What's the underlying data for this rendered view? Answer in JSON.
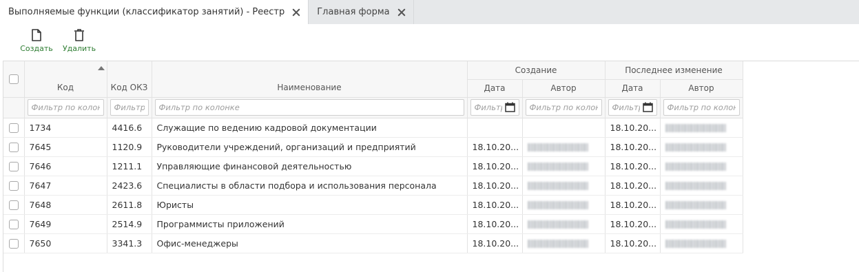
{
  "tabs": [
    {
      "label": "Выполняемые функции (классификатор занятий) - Реестр",
      "active": true
    },
    {
      "label": "Главная форма",
      "active": false
    }
  ],
  "toolbar": {
    "create_label": "Создать",
    "delete_label": "Удалить"
  },
  "grid": {
    "headers": {
      "code": "Код",
      "okz": "Код ОКЗ",
      "name": "Наименование",
      "creation": "Создание",
      "last_change": "Последнее изменение",
      "date": "Дата",
      "author": "Автор"
    },
    "filter_placeholder": "Фильтр по колонке",
    "rows": [
      {
        "code": "1734",
        "okz": "4416.6",
        "name": "Служащие по ведению кадровой документации",
        "created_date": "",
        "created_author": "",
        "changed_date": "18.10.20...",
        "changed_author": "(blurred)"
      },
      {
        "code": "7645",
        "okz": "1120.9",
        "name": "Руководители учреждений, организаций и предприятий",
        "created_date": "18.10.20...",
        "created_author": "(blurred)",
        "changed_date": "18.10.20...",
        "changed_author": "(blurred)"
      },
      {
        "code": "7646",
        "okz": "1211.1",
        "name": "Управляющие финансовой деятельностью",
        "created_date": "18.10.20...",
        "created_author": "(blurred)",
        "changed_date": "18.10.20...",
        "changed_author": "(blurred)"
      },
      {
        "code": "7647",
        "okz": "2423.6",
        "name": "Специалисты в области подбора и использования персонала",
        "created_date": "18.10.20...",
        "created_author": "(blurred)",
        "changed_date": "18.10.20...",
        "changed_author": "(blurred)"
      },
      {
        "code": "7648",
        "okz": "2611.8",
        "name": "Юристы",
        "created_date": "18.10.20...",
        "created_author": "(blurred)",
        "changed_date": "18.10.20...",
        "changed_author": "(blurred)"
      },
      {
        "code": "7649",
        "okz": "2514.9",
        "name": "Программисты приложений",
        "created_date": "18.10.20...",
        "created_author": "(blurred)",
        "changed_date": "18.10.20...",
        "changed_author": "(blurred)"
      },
      {
        "code": "7650",
        "okz": "3341.3",
        "name": "Офис-менеджеры",
        "created_date": "18.10.20...",
        "created_author": "(blurred)",
        "changed_date": "18.10.20...",
        "changed_author": "(blurred)"
      }
    ]
  },
  "colors": {
    "accent_green": "#2e7d32",
    "tabbar_bg": "#e6e8ea",
    "header_bg": "#f7f7f7"
  }
}
